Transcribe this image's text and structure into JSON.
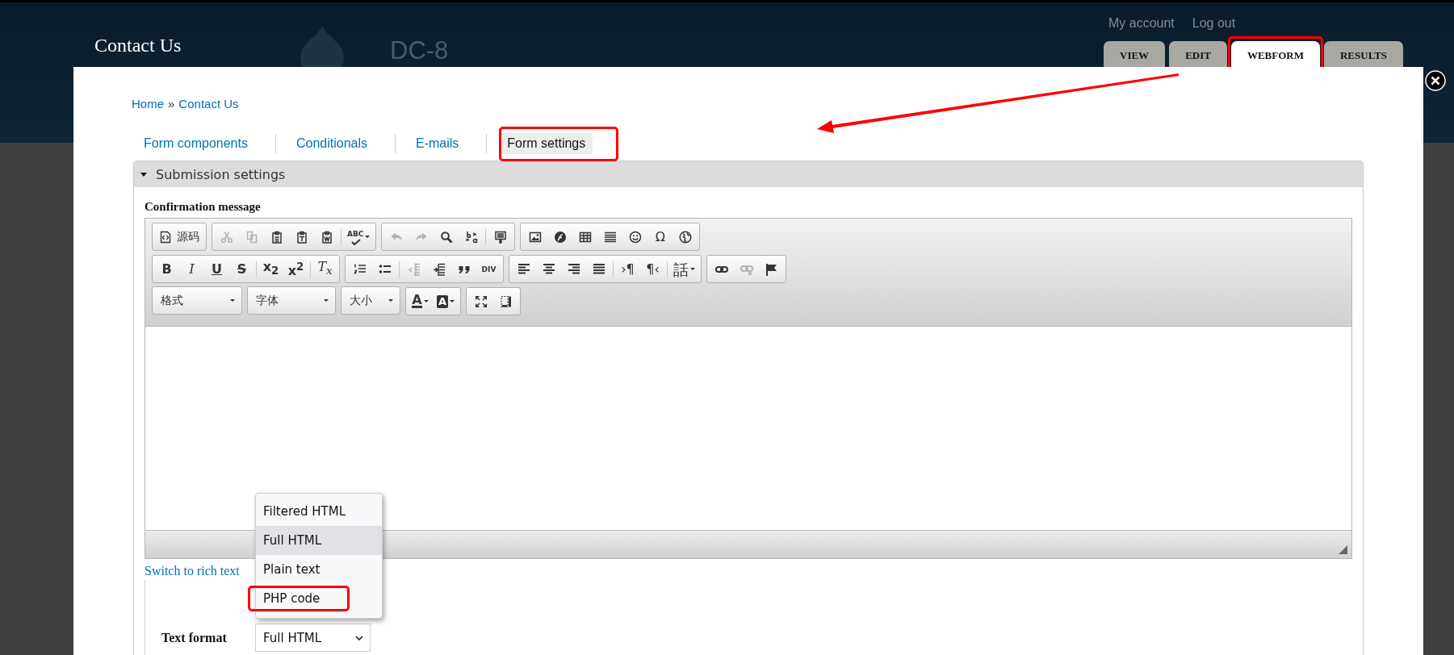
{
  "header": {
    "site_title": "Contact Us",
    "site_name": "DC-8",
    "user_links": [
      "My account",
      "Log out"
    ],
    "tabs": [
      {
        "label": "VIEW",
        "selected": false,
        "highlighted": false
      },
      {
        "label": "EDIT",
        "selected": false,
        "highlighted": false
      },
      {
        "label": "WEBFORM",
        "selected": true,
        "highlighted": true
      },
      {
        "label": "RESULTS",
        "selected": false,
        "highlighted": false
      }
    ]
  },
  "breadcrumb": {
    "items": [
      "Home",
      "Contact Us"
    ],
    "separator": "»"
  },
  "subtabs": [
    {
      "label": "Form components",
      "selected": false,
      "highlighted": false
    },
    {
      "label": "Conditionals",
      "selected": false,
      "highlighted": false
    },
    {
      "label": "E-mails",
      "selected": false,
      "highlighted": false
    },
    {
      "label": "Form settings",
      "selected": true,
      "highlighted": true
    }
  ],
  "fieldset": {
    "legend": "Submission settings",
    "expanded": true,
    "field_label": "Confirmation message",
    "editor": {
      "toolbar": [
        [
          [
            {
              "kind": "source",
              "label": "源码"
            }
          ],
          [
            {
              "kind": "icon",
              "disabled": true
            },
            {
              "kind": "icon",
              "disabled": true
            },
            {
              "kind": "icon",
              "disabled": false
            },
            {
              "kind": "icon",
              "disabled": false
            },
            {
              "kind": "icon",
              "disabled": false
            },
            {
              "kind": "separator"
            },
            {
              "kind": "spell",
              "glyph": "ABC",
              "disabled": false
            }
          ],
          [
            {
              "kind": "icon",
              "disabled": true
            },
            {
              "kind": "icon",
              "disabled": true
            },
            {
              "kind": "icon",
              "disabled": false
            },
            {
              "kind": "icon",
              "disabled": false
            },
            {
              "kind": "separator"
            },
            {
              "kind": "icon",
              "disabled": false
            }
          ],
          [
            {
              "kind": "icon",
              "disabled": false
            },
            {
              "kind": "icon",
              "disabled": false
            },
            {
              "kind": "icon",
              "disabled": false
            },
            {
              "kind": "icon",
              "disabled": false
            },
            {
              "kind": "icon",
              "disabled": false
            },
            {
              "kind": "glyph",
              "glyph": "Ω",
              "disabled": false
            },
            {
              "kind": "icon",
              "disabled": false
            }
          ]
        ],
        [
          [
            {
              "kind": "bold",
              "glyph": "B",
              "disabled": false
            },
            {
              "kind": "italic",
              "glyph": "I",
              "disabled": false
            },
            {
              "kind": "underline",
              "glyph": "U",
              "disabled": false
            },
            {
              "kind": "strike",
              "glyph": "S",
              "disabled": false
            },
            {
              "kind": "separator"
            },
            {
              "kind": "bold",
              "glyph": "x$_{2}$",
              "disabled": false
            },
            {
              "kind": "bold",
              "glyph": "x$^{2}$",
              "disabled": false
            },
            {
              "kind": "separator"
            },
            {
              "kind": "italic",
              "glyph": "T$_{x}$",
              "disabled": false
            }
          ],
          [
            {
              "kind": "icon",
              "disabled": false
            },
            {
              "kind": "icon",
              "disabled": false
            },
            {
              "kind": "separator"
            },
            {
              "kind": "icon",
              "disabled": true
            },
            {
              "kind": "icon",
              "disabled": false
            },
            {
              "kind": "icon",
              "disabled": false
            },
            {
              "kind": "small",
              "glyph": "DIV",
              "disabled": false
            }
          ],
          [
            {
              "kind": "icon",
              "disabled": false
            },
            {
              "kind": "icon",
              "disabled": false
            },
            {
              "kind": "icon",
              "disabled": false
            },
            {
              "kind": "icon",
              "disabled": false
            },
            {
              "kind": "separator"
            },
            {
              "kind": "glyph",
              "glyph": "›¶",
              "disabled": false
            },
            {
              "kind": "glyph",
              "glyph": "¶‹",
              "disabled": false
            },
            {
              "kind": "separator"
            },
            {
              "kind": "menu",
              "glyph": "話",
              "disabled": false
            }
          ],
          [
            {
              "kind": "icon",
              "disabled": false
            },
            {
              "kind": "icon",
              "disabled": true
            },
            {
              "kind": "icon",
              "disabled": false
            }
          ]
        ],
        [
          [
            {
              "kind": "combo",
              "label": "格式"
            }
          ],
          [
            {
              "kind": "combo",
              "label": "字体"
            }
          ],
          [
            {
              "kind": "combo",
              "label": "大小"
            }
          ],
          [
            {
              "kind": "forecolor",
              "glyph": "A",
              "disabled": false
            },
            {
              "kind": "backcolor",
              "glyph": "A",
              "disabled": false
            }
          ],
          [
            {
              "kind": "icon",
              "disabled": false
            },
            {
              "kind": "icon",
              "disabled": false
            }
          ]
        ]
      ]
    },
    "switch_link": "Switch to rich text",
    "text_format": {
      "label": "Text format",
      "value": "Full HTML",
      "open": true,
      "options": [
        {
          "label": "Filtered HTML",
          "selected": false,
          "highlighted": false
        },
        {
          "label": "Full HTML",
          "selected": true,
          "highlighted": false
        },
        {
          "label": "Plain text",
          "selected": false,
          "highlighted": false
        },
        {
          "label": "PHP code",
          "selected": false,
          "highlighted": true
        }
      ]
    }
  }
}
